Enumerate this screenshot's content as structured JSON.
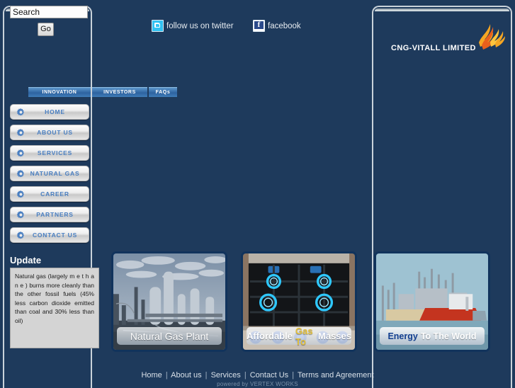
{
  "site": {
    "brand_name": "CNG-VITALL LIMITED",
    "logo_icon": "flame-logo-icon",
    "background_color": "#1e3a5c",
    "accent_color": "#4a7fc1",
    "logo_colors": [
      "#f0a020",
      "#e8601c",
      "#ffcc33"
    ]
  },
  "search": {
    "value": "Search",
    "placeholder": "Search",
    "button_label": "Go"
  },
  "social": [
    {
      "icon": "twitter-icon",
      "label": "follow us on twitter"
    },
    {
      "icon": "facebook-icon",
      "label": "facebook"
    }
  ],
  "topnav": {
    "items": [
      {
        "label": "INNOVATION"
      },
      {
        "label": "INVESTORS"
      },
      {
        "label": "FAQs"
      }
    ]
  },
  "sidebar": {
    "icon": "gear-icon",
    "items": [
      {
        "label": "HOME"
      },
      {
        "label": "ABOUT US"
      },
      {
        "label": "SERVICES"
      },
      {
        "label": "NATURAL GAS"
      },
      {
        "label": "CAREER"
      },
      {
        "label": "PARTNERS"
      },
      {
        "label": "CONTACT US"
      }
    ]
  },
  "update": {
    "title": "Update",
    "body": "Natural gas (largely m e t h a n e ) burns more cleanly than the other fossil fuels (45% less carbon dioxide emitted than coal and 30% less than oil)"
  },
  "cards": [
    {
      "art": "natural-gas-plant-photo",
      "caption_parts": [
        "Natural Gas Plant"
      ]
    },
    {
      "art": "gas-stove-burners-photo",
      "caption_parts": [
        "Affordable ",
        "Gas To",
        " Masses"
      ]
    },
    {
      "art": "lng-tanker-refinery-photo",
      "caption_parts": [
        "Energy",
        " To The World"
      ]
    }
  ],
  "footer": {
    "links": [
      {
        "label": "Home"
      },
      {
        "label": "About us"
      },
      {
        "label": "Services"
      },
      {
        "label": "Contact Us"
      },
      {
        "label": "Terms and Agreement"
      }
    ],
    "separator": "|",
    "powered_by": "powered by VERTEX WORKS"
  }
}
